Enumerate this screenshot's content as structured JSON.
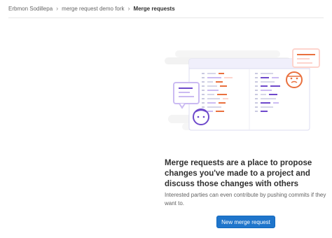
{
  "breadcrumb": {
    "items": [
      "Erbmon Sodillepa",
      "merge request demo fork",
      "Merge requests"
    ],
    "separator": "›"
  },
  "empty_state": {
    "title": "Merge requests are a place to propose changes you've made to a project and discuss those changes with others",
    "description": "Interested parties can even contribute by pushing commits if they want to.",
    "button_label": "New merge request"
  },
  "colors": {
    "primary": "#1f75cb",
    "orange": "#e9703e",
    "purple": "#6e49cb",
    "light_purple": "#cbbbf2",
    "light_orange": "#fdd4cd"
  },
  "icons": [
    "chevron-right-icon",
    "chat-bubble-icon",
    "avatar-icon"
  ]
}
